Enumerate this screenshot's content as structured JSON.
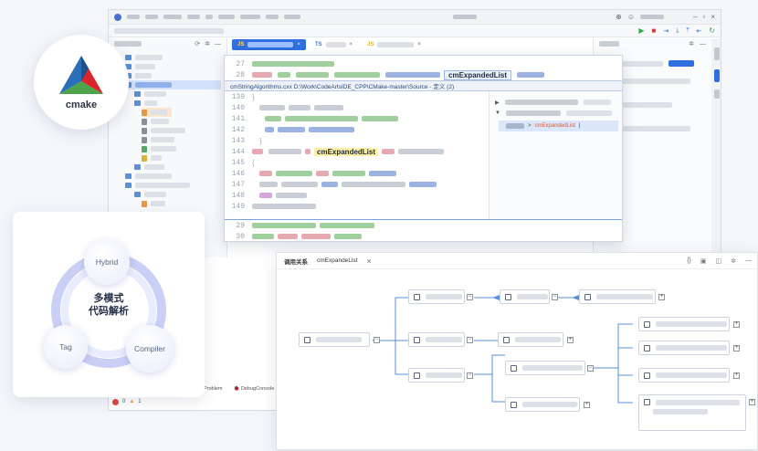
{
  "logo": {
    "text": "cmake"
  },
  "peek": {
    "path": "cmStringAlgorithms.cxx  D:\\Work\\CodeArtsIDE_CPP\\CMake-master\\Source - 定义 (2)",
    "symbol": "cmExpandedList",
    "lines_top": [
      "27",
      "28"
    ],
    "lines": [
      "139",
      "140",
      "141",
      "142",
      "143",
      "144",
      "145",
      "146",
      "147",
      "148",
      "149"
    ],
    "lines_bottom": [
      "29",
      "30"
    ],
    "ref_entry": "cmExpandedList"
  },
  "card": {
    "center": "多模式\n代码解析",
    "hybrid": "Hybrid",
    "tag": "Tag",
    "compiler": "Compiler"
  },
  "status": {
    "problem": "Problem",
    "debug": "DebugConsole",
    "errors": "0",
    "warnings": "1"
  },
  "callwin": {
    "tab1": "调用关系",
    "tab2": "cmExpandeList",
    "close": "×"
  },
  "tabs": {
    "t1": "JS",
    "t2": "TS",
    "t3": "JS"
  }
}
